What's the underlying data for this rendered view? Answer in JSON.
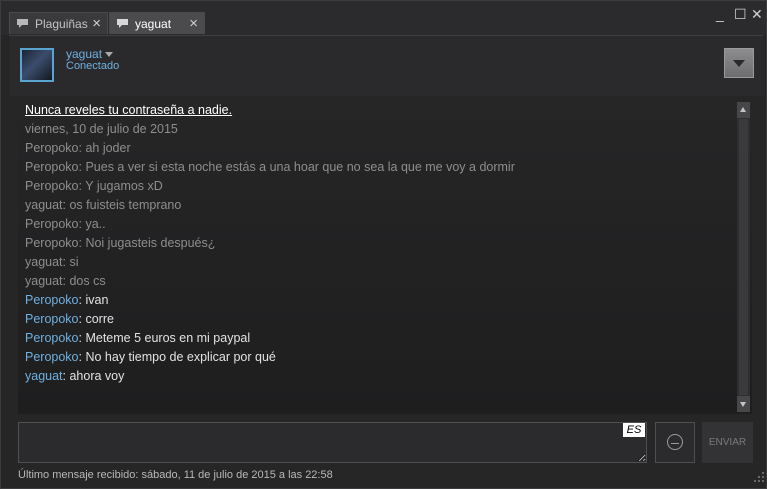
{
  "tabs": [
    {
      "label": "Plaguiñas",
      "close": "×"
    },
    {
      "label": "yaguat",
      "close": "×"
    }
  ],
  "window_controls": {
    "minimize": "_",
    "maximize": "☐",
    "close": "✕"
  },
  "friend": {
    "name": "yaguat",
    "status": "Conectado"
  },
  "warning": "Nunca reveles tu contraseña a nadie.",
  "date_header": "viernes, 10 de julio de 2015",
  "history": [
    "Peropoko: ah joder",
    "Peropoko: Pues a ver si esta noche estás a una hoar que no sea la que me voy a dormir",
    "Peropoko: Y jugamos xD",
    "yaguat: os fuisteis temprano",
    "Peropoko: ya..",
    "Peropoko: Noi jugasteis después¿",
    "yaguat: si",
    "yaguat: dos cs"
  ],
  "new_messages": [
    {
      "who": "Peropoko",
      "text": ": ivan"
    },
    {
      "who": "Peropoko",
      "text": ": corre"
    },
    {
      "who": "Peropoko",
      "text": ": Meteme 5 euros en mi paypal"
    },
    {
      "who": "Peropoko",
      "text": ": No hay tiempo de explicar por qué"
    },
    {
      "who": "yaguat",
      "text": ": ahora voy"
    }
  ],
  "input": {
    "value": "",
    "language": "ES"
  },
  "send_label": "ENVIAR",
  "footer": "Último mensaje recibido: sábado, 11 de julio de 2015 a las 22:58",
  "colors": {
    "accent": "#6fb0e0",
    "background": "#262627"
  },
  "icons": [
    "chat-bubble-icon",
    "caret-down-icon",
    "menu-arrow-icon",
    "emoticon-icon",
    "resize-grip-icon"
  ]
}
